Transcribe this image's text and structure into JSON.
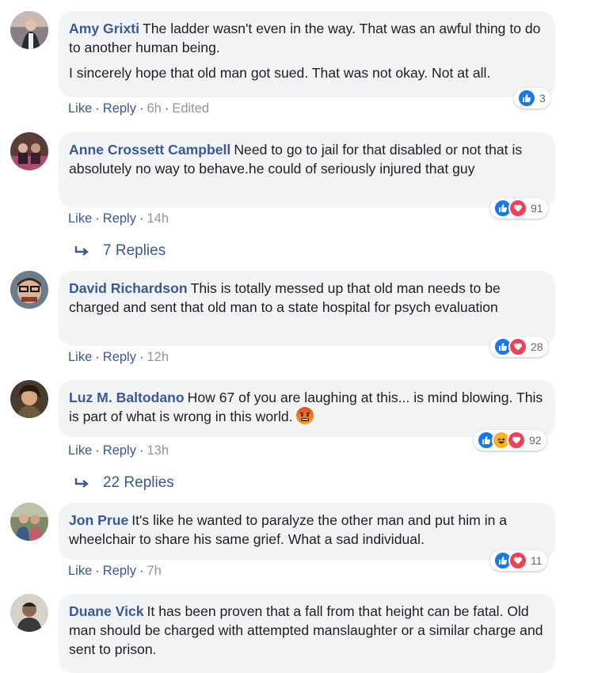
{
  "comments": [
    {
      "author": "Amy Grixti",
      "text": "The ladder wasn't even in the way. That was an awful thing to do to another human being.",
      "text2": "I sincerely hope that old man got sued. That was not okay. Not at all.",
      "like": "Like",
      "reply": "Reply",
      "time": "6h",
      "edited": "Edited",
      "reaction_count": "3",
      "reactions": [
        "like"
      ]
    },
    {
      "author": "Anne Crossett Campbell",
      "text": "Need to go to jail for that disabled or not that is absolutely no way to behave.he could of seriously injured that guy",
      "like": "Like",
      "reply": "Reply",
      "time": "14h",
      "reaction_count": "91",
      "reactions": [
        "like",
        "love"
      ],
      "replies": "7 Replies"
    },
    {
      "author": "David Richardson",
      "text": "This is totally messed up that old man needs to be charged and sent that old man to a state hospital for psych evaluation",
      "like": "Like",
      "reply": "Reply",
      "time": "12h",
      "reaction_count": "28",
      "reactions": [
        "like",
        "love"
      ]
    },
    {
      "author": "Luz M. Baltodano",
      "text": "How 67 of you are laughing at this... is mind blowing. This is part of what is wrong in this world.",
      "emoji": "angry-face-emoji",
      "like": "Like",
      "reply": "Reply",
      "time": "13h",
      "reaction_count": "92",
      "reactions": [
        "like",
        "haha",
        "love"
      ],
      "replies": "22 Replies"
    },
    {
      "author": "Jon Prue",
      "text": "It's like he wanted to paralyze the other man and put him in a wheelchair to share his same grief. What a sad individual.",
      "like": "Like",
      "reply": "Reply",
      "time": "7h",
      "reaction_count": "11",
      "reactions": [
        "like",
        "love"
      ]
    },
    {
      "author": "Duane Vick",
      "text": "It has been proven that a fall from that height can be fatal. Old man should be charged with attempted manslaughter or a similar charge and sent to prison."
    }
  ],
  "colors": {
    "name_link": "#385898",
    "bubble_bg": "#f2f3f5",
    "like_blue": "#1877f2",
    "love_red": "#f33e58",
    "haha_yellow": "#f7b125"
  }
}
